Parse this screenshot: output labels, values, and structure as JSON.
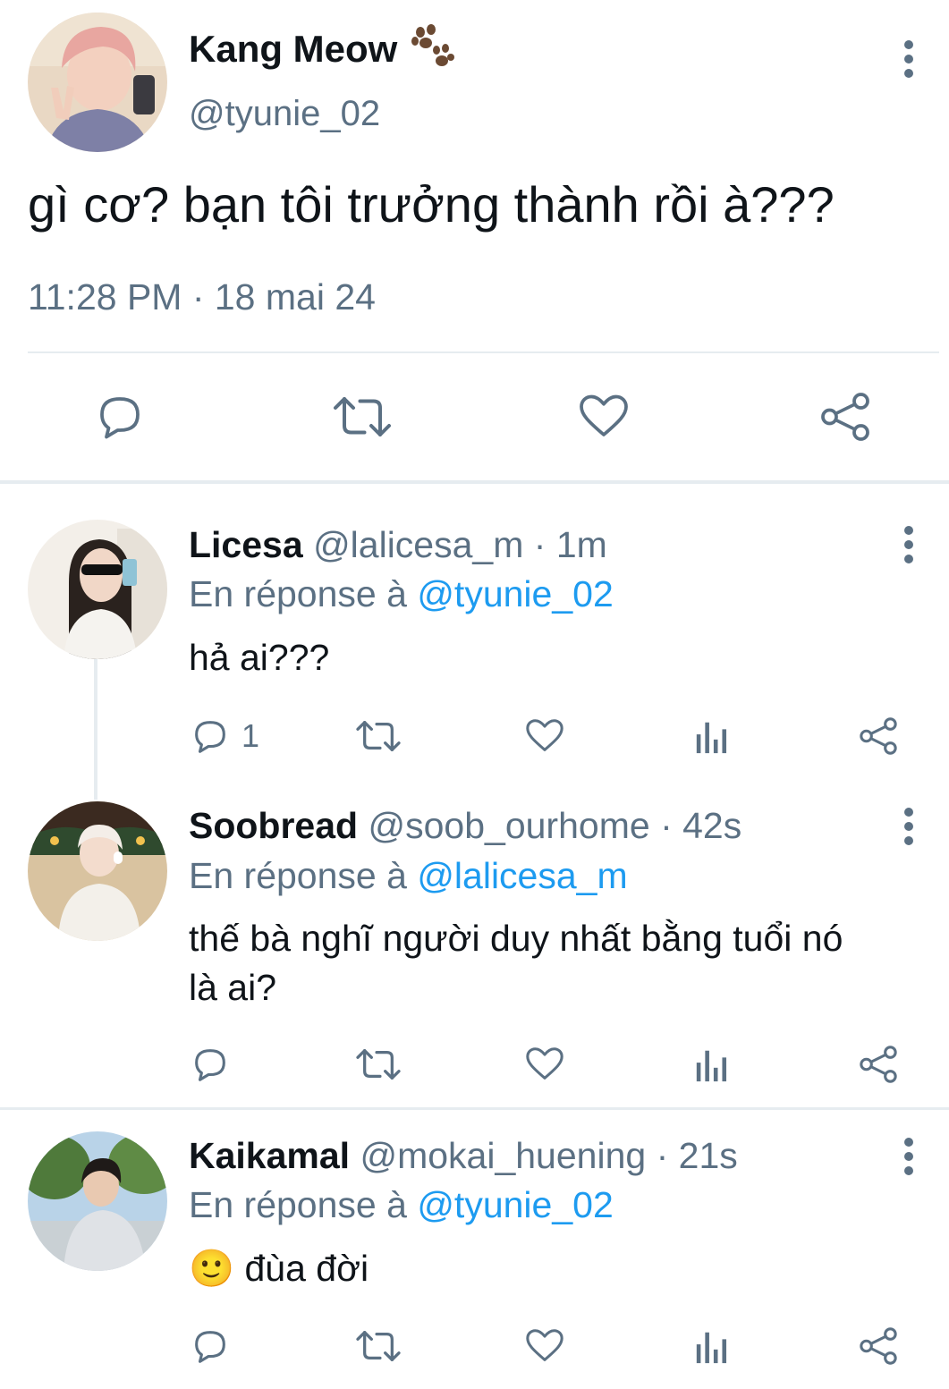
{
  "main_tweet": {
    "display_name": "Kang Meow",
    "handle": "@tyunie_02",
    "text": "gì cơ? bạn tôi trưởng thành rồi à???",
    "timestamp": "11:28 PM · 18 mai 24",
    "actions": [
      "reply-icon",
      "retweet-icon",
      "like-icon",
      "share-icon"
    ]
  },
  "replies": [
    {
      "display_name": "Licesa",
      "handle": "@lalicesa_m",
      "time": "· 1m",
      "reply_prefix": "En réponse à",
      "reply_to": "@tyunie_02",
      "text": "hả ai???",
      "reply_count": "1"
    },
    {
      "display_name": "Soobread",
      "handle": "@soob_ourhome",
      "time": "· 42s",
      "reply_prefix": "En réponse à",
      "reply_to": "@lalicesa_m",
      "text_line1": "thế bà nghĩ người duy nhất bằng tuổi nó",
      "text_line2": "là ai?"
    },
    {
      "display_name": "Kaikamal",
      "handle": "@mokai_huening",
      "time": "· 21s",
      "reply_prefix": "En réponse à",
      "reply_to": "@tyunie_02",
      "emoji": "🙂",
      "text": "đùa đời"
    }
  ],
  "colors": {
    "muted": "#5b7083",
    "link": "#1d9bf0",
    "divider": "#e6ecf0"
  }
}
